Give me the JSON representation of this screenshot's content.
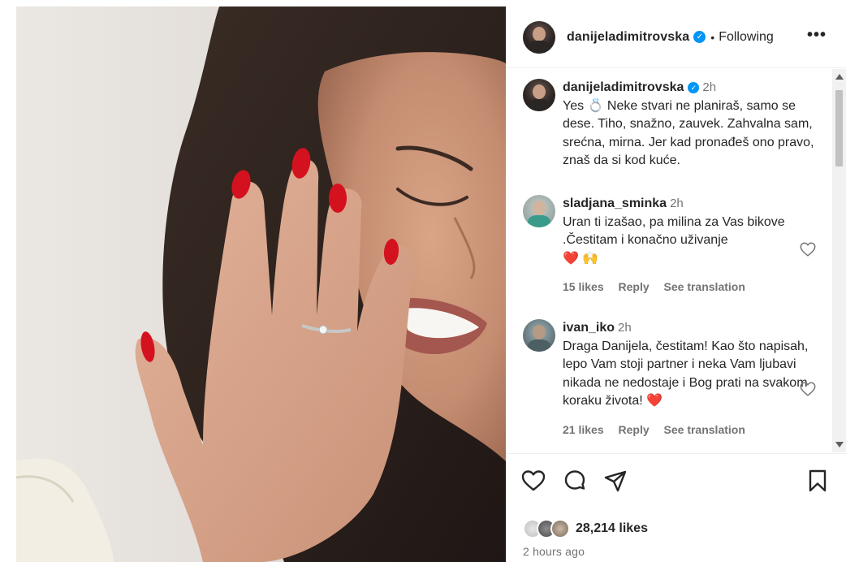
{
  "post": {
    "username": "danijeladimitrovska",
    "verified": true,
    "follow_status": "Following",
    "more_icon": "more-horizontal-icon"
  },
  "caption": {
    "username": "danijeladimitrovska",
    "time": "2h",
    "text": "Yes 💍 Neke stvari ne planiraš, samo se dese. Tiho, snažno, zauvek. Zahvalna sam, srećna, mirna. Jer kad pronađeš ono pravo, znaš da si kod kuće."
  },
  "comments": [
    {
      "username": "sladjana_sminka",
      "time": "2h",
      "text": "Uran ti izašao, pa milina za Vas bikove .Čestitam i konačno uživanje",
      "emoji": "❤️ 🙌",
      "likes": "15 likes",
      "reply": "Reply",
      "translate": "See translation"
    },
    {
      "username": "ivan_iko",
      "time": "2h",
      "text": "Draga Danijela, čestitam! Kao što napisah, lepo Vam stoji partner i neka Vam ljubavi nikada ne nedostaje i Bog prati na svakom koraku života!",
      "emoji": "❤️",
      "likes": "21 likes",
      "reply": "Reply",
      "translate": "See translation"
    }
  ],
  "actions": {
    "like_icon": "heart-icon",
    "comment_icon": "comment-bubble-icon",
    "share_icon": "paper-plane-icon",
    "save_icon": "bookmark-icon"
  },
  "likes": "28,214 likes",
  "posted_ago": "2 hours ago",
  "colors": {
    "verified": "#0095f6",
    "text": "#262626",
    "secondary": "#737373",
    "nail_red": "#d4121f"
  }
}
